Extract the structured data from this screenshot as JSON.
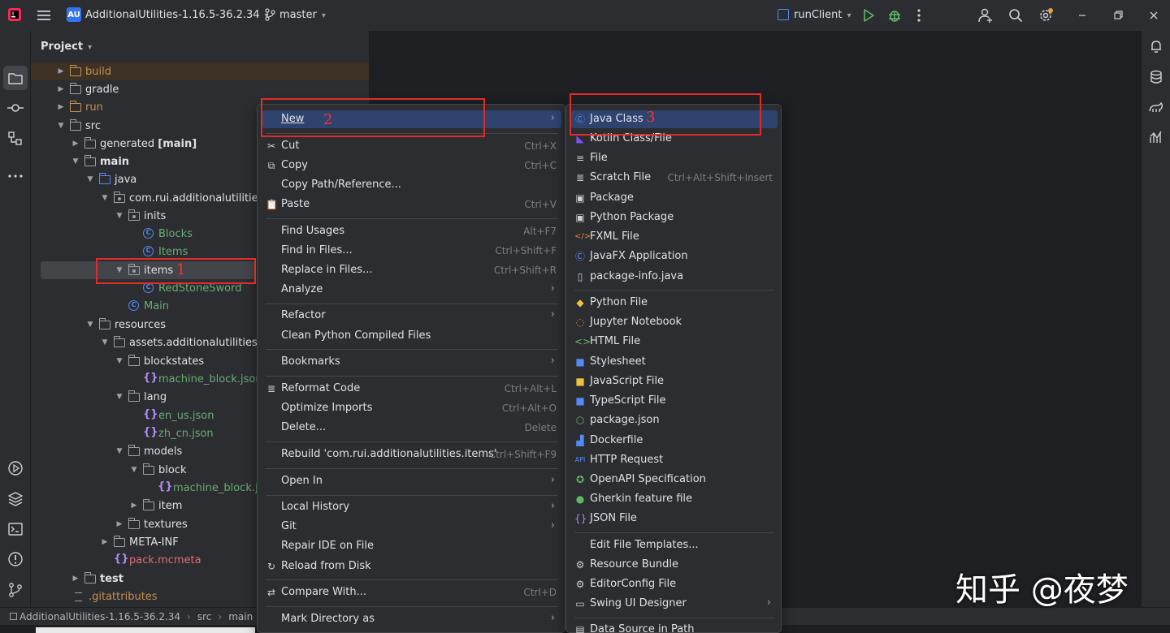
{
  "titlebar": {
    "badge": "AU",
    "project_name": "AdditionalUtilities-1.16.5-36.2.34",
    "branch": "master",
    "run_config": "runClient"
  },
  "project_panel": {
    "title": "Project",
    "rows": [
      {
        "label": "build",
        "suffix": ""
      },
      {
        "label": "gradle",
        "suffix": ""
      },
      {
        "label": "run",
        "suffix": ""
      },
      {
        "label": "src",
        "suffix": ""
      },
      {
        "label": "generated",
        "suffix": "[main]"
      },
      {
        "label": "main",
        "suffix": ""
      },
      {
        "label": "java",
        "suffix": ""
      },
      {
        "label": "com.rui.additionalutilities",
        "suffix": ""
      },
      {
        "label": "inits",
        "suffix": ""
      },
      {
        "label": "Blocks",
        "suffix": ""
      },
      {
        "label": "Items",
        "suffix": ""
      },
      {
        "label": "items",
        "suffix": ""
      },
      {
        "label": "RedStoneSword",
        "suffix": ""
      },
      {
        "label": "Main",
        "suffix": ""
      },
      {
        "label": "resources",
        "suffix": ""
      },
      {
        "label": "assets.additionalutilities",
        "suffix": ""
      },
      {
        "label": "blockstates",
        "suffix": ""
      },
      {
        "label": "machine_block.json",
        "suffix": ""
      },
      {
        "label": "lang",
        "suffix": ""
      },
      {
        "label": "en_us.json",
        "suffix": ""
      },
      {
        "label": "zh_cn.json",
        "suffix": ""
      },
      {
        "label": "models",
        "suffix": ""
      },
      {
        "label": "block",
        "suffix": ""
      },
      {
        "label": "machine_block.jso",
        "suffix": ""
      },
      {
        "label": "item",
        "suffix": ""
      },
      {
        "label": "textures",
        "suffix": ""
      },
      {
        "label": "META-INF",
        "suffix": ""
      },
      {
        "label": "pack.mcmeta",
        "suffix": ""
      },
      {
        "label": "test",
        "suffix": ""
      },
      {
        "label": ".gitattributes",
        "suffix": ""
      }
    ]
  },
  "statusbar": {
    "crumbs": [
      "AdditionalUtilities-1.16.5-36.2.34",
      "src",
      "main"
    ]
  },
  "context_menu": {
    "items": [
      {
        "label": "New",
        "shortcut": ""
      },
      {
        "label": "Cut",
        "shortcut": "Ctrl+X"
      },
      {
        "label": "Copy",
        "shortcut": "Ctrl+C"
      },
      {
        "label": "Copy Path/Reference...",
        "shortcut": ""
      },
      {
        "label": "Paste",
        "shortcut": "Ctrl+V"
      },
      {
        "label": "Find Usages",
        "shortcut": "Alt+F7"
      },
      {
        "label": "Find in Files...",
        "shortcut": "Ctrl+Shift+F"
      },
      {
        "label": "Replace in Files...",
        "shortcut": "Ctrl+Shift+R"
      },
      {
        "label": "Analyze",
        "shortcut": ""
      },
      {
        "label": "Refactor",
        "shortcut": ""
      },
      {
        "label": "Clean Python Compiled Files",
        "shortcut": ""
      },
      {
        "label": "Bookmarks",
        "shortcut": ""
      },
      {
        "label": "Reformat Code",
        "shortcut": "Ctrl+Alt+L"
      },
      {
        "label": "Optimize Imports",
        "shortcut": "Ctrl+Alt+O"
      },
      {
        "label": "Delete...",
        "shortcut": "Delete"
      },
      {
        "label": "Rebuild 'com.rui.additionalutilities.items'",
        "shortcut": "Ctrl+Shift+F9"
      },
      {
        "label": "Open In",
        "shortcut": ""
      },
      {
        "label": "Local History",
        "shortcut": ""
      },
      {
        "label": "Git",
        "shortcut": ""
      },
      {
        "label": "Repair IDE on File",
        "shortcut": ""
      },
      {
        "label": "Reload from Disk",
        "shortcut": ""
      },
      {
        "label": "Compare With...",
        "shortcut": "Ctrl+D"
      },
      {
        "label": "Mark Directory as",
        "shortcut": ""
      }
    ]
  },
  "new_submenu": {
    "items": [
      {
        "label": "Java Class",
        "shortcut": ""
      },
      {
        "label": "Kotlin Class/File",
        "shortcut": ""
      },
      {
        "label": "File",
        "shortcut": ""
      },
      {
        "label": "Scratch File",
        "shortcut": "Ctrl+Alt+Shift+Insert"
      },
      {
        "label": "Package",
        "shortcut": ""
      },
      {
        "label": "Python Package",
        "shortcut": ""
      },
      {
        "label": "FXML File",
        "shortcut": ""
      },
      {
        "label": "JavaFX Application",
        "shortcut": ""
      },
      {
        "label": "package-info.java",
        "shortcut": ""
      },
      {
        "label": "Python File",
        "shortcut": ""
      },
      {
        "label": "Jupyter Notebook",
        "shortcut": ""
      },
      {
        "label": "HTML File",
        "shortcut": ""
      },
      {
        "label": "Stylesheet",
        "shortcut": ""
      },
      {
        "label": "JavaScript File",
        "shortcut": ""
      },
      {
        "label": "TypeScript File",
        "shortcut": ""
      },
      {
        "label": "package.json",
        "shortcut": ""
      },
      {
        "label": "Dockerfile",
        "shortcut": ""
      },
      {
        "label": "HTTP Request",
        "shortcut": ""
      },
      {
        "label": "OpenAPI Specification",
        "shortcut": ""
      },
      {
        "label": "Gherkin feature file",
        "shortcut": ""
      },
      {
        "label": "JSON File",
        "shortcut": ""
      },
      {
        "label": "Edit File Templates...",
        "shortcut": ""
      },
      {
        "label": "Resource Bundle",
        "shortcut": ""
      },
      {
        "label": "EditorConfig File",
        "shortcut": ""
      },
      {
        "label": "Swing UI Designer",
        "shortcut": ""
      },
      {
        "label": "Data Source in Path",
        "shortcut": ""
      }
    ]
  },
  "annotations": {
    "step1": "1",
    "step2": "2",
    "step3": "3",
    "watermark": "知乎 @夜梦"
  },
  "colors": {
    "accent": "#3574f0",
    "highlight": "#2e436e",
    "annotation": "#e32b2b"
  }
}
